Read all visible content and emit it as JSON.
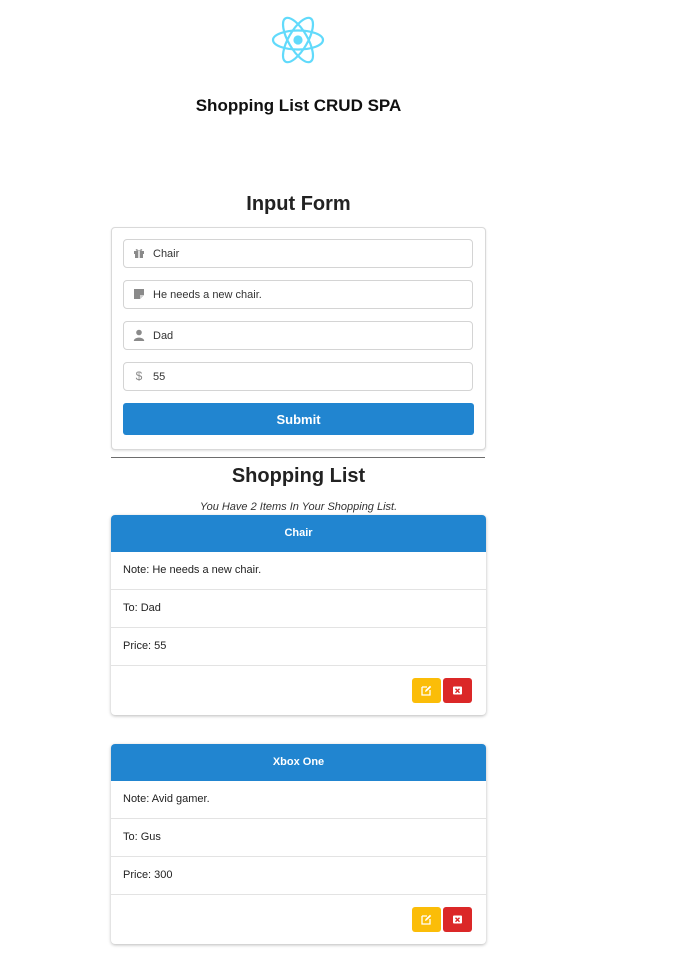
{
  "header": {
    "title": "Shopping List CRUD SPA",
    "logo_icon": "react-atom-icon",
    "logo_color": "#61dafb"
  },
  "form": {
    "title": "Input Form",
    "fields": [
      {
        "icon": "gift-icon",
        "value": "Chair"
      },
      {
        "icon": "sticky-note-icon",
        "value": "He needs a new chair."
      },
      {
        "icon": "user-icon",
        "value": "Dad"
      },
      {
        "icon": "dollar-icon",
        "value": "55"
      }
    ],
    "submit_label": "Submit"
  },
  "list": {
    "title": "Shopping List",
    "count_text": "You Have 2 Items In Your Shopping List.",
    "items": [
      {
        "name": "Chair",
        "note": "Note: He needs a new chair.",
        "to": "To: Dad",
        "price": "Price: 55"
      },
      {
        "name": "Xbox One",
        "note": "Note: Avid gamer.",
        "to": "To: Gus",
        "price": "Price: 300"
      }
    ]
  },
  "colors": {
    "primary": "#2185d0",
    "edit": "#fbbd08",
    "delete": "#db2828"
  }
}
